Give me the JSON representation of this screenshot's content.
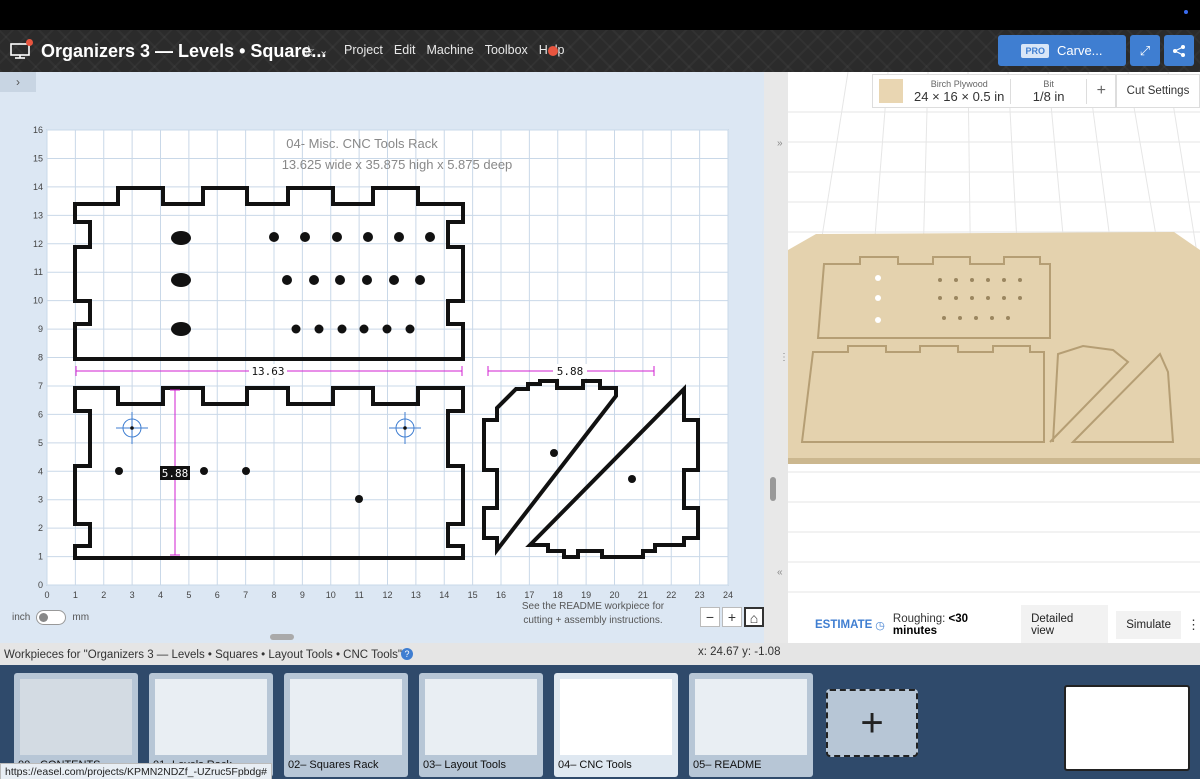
{
  "header": {
    "title": "Organizers 3 — Levels • Square...",
    "menu": [
      "Project",
      "Edit",
      "Machine",
      "Toolbox",
      "Help"
    ],
    "carve": {
      "pro_badge": "PRO",
      "label": "Carve..."
    }
  },
  "design": {
    "label_title": "04- Misc. CNC Tools Rack",
    "label_dims": "13.625 wide x 35.875 high x 5.875 deep",
    "dim_width": "13.63",
    "dim_height": "5.88",
    "dim_depth": "5.88",
    "x_ticks": [
      "0",
      "1",
      "2",
      "3",
      "4",
      "5",
      "6",
      "7",
      "8",
      "9",
      "10",
      "11",
      "12",
      "13",
      "14",
      "15",
      "16",
      "17",
      "18",
      "19",
      "20",
      "21",
      "22",
      "23",
      "24"
    ],
    "y_ticks": [
      "0",
      "1",
      "2",
      "3",
      "4",
      "5",
      "6",
      "7",
      "8",
      "9",
      "10",
      "11",
      "12",
      "13",
      "14",
      "15",
      "16"
    ],
    "units": {
      "left": "inch",
      "right": "mm"
    },
    "readme_note": "See the README workpiece for cutting + assembly instructions.",
    "zoom": {
      "minus": "−",
      "plus": "+"
    },
    "expand": "›"
  },
  "preview": {
    "material_name": "Birch Plywood",
    "material_size": "24 × 16 × 0.5 in",
    "bit_label": "Bit",
    "bit_value": "1/8 in",
    "add": "+",
    "cut_settings": "Cut Settings",
    "estimate": "ESTIMATE",
    "roughing_label": "Roughing:",
    "roughing_value": "<30 minutes",
    "detailed_view": "Detailed view",
    "simulate": "Simulate"
  },
  "workpieces": {
    "label": "Workpieces for \"Organizers 3 — Levels • Squares • Layout Tools • CNC Tools\"",
    "coords": "x: 24.67 y: -1.08",
    "items": [
      {
        "label": "00 - CONTENTS"
      },
      {
        "label": "01- Levels Rack"
      },
      {
        "label": "02– Squares Rack"
      },
      {
        "label": "03– Layout Tools"
      },
      {
        "label": "04– CNC Tools"
      },
      {
        "label": "05– README"
      }
    ],
    "selected_index": 4
  },
  "status_url": "https://easel.com/projects/KPMN2NDZf_-UZruc5Fpbdg#",
  "colors": {
    "accent": "#3f7ed1",
    "dimension": "#d21fd2",
    "wood": "#e4d2ae"
  }
}
